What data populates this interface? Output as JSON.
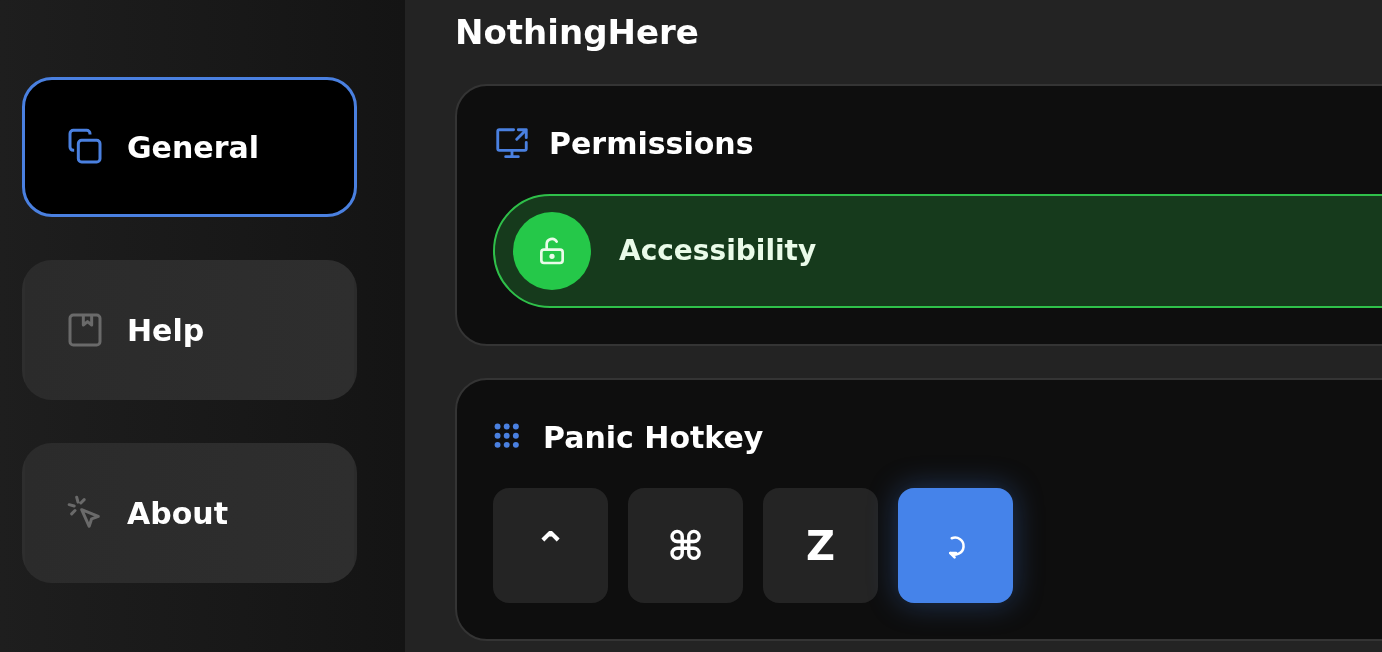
{
  "sidebar": {
    "items": [
      {
        "label": "General",
        "kind": "general",
        "selected": true
      },
      {
        "label": "Help",
        "kind": "help",
        "selected": false
      },
      {
        "label": "About",
        "kind": "about",
        "selected": false
      }
    ]
  },
  "app_title": "NothingHere",
  "permissions": {
    "title": "Permissions",
    "items": [
      {
        "label": "Accessibility",
        "granted": true
      }
    ]
  },
  "panic_hotkey": {
    "title": "Panic Hotkey",
    "keys": [
      "⌃",
      "⌘",
      "Z"
    ],
    "reset_button": {
      "kind": "reset"
    }
  }
}
